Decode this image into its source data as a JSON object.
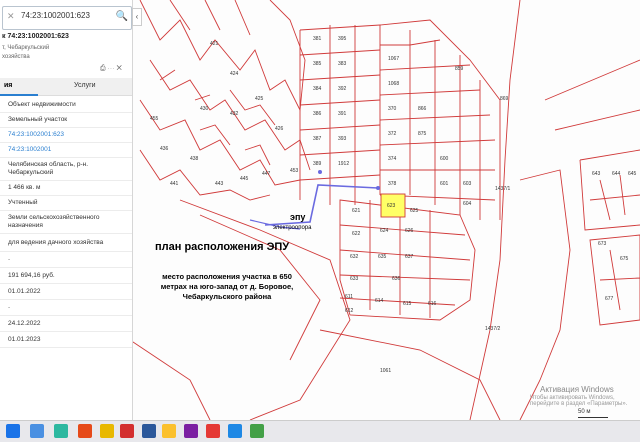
{
  "search": {
    "value": "74:23:1002001:623"
  },
  "parcel": {
    "title": "к 74:23:1002001:623",
    "location_short": "т, Чебаркульский",
    "category_short": "хозяйства"
  },
  "tabs": [
    {
      "label": "ия"
    },
    {
      "label": "Услуги"
    }
  ],
  "info_rows": [
    {
      "text": "Объект недвижимости"
    },
    {
      "text": "Земельный участок"
    },
    {
      "text": "74:23:1002001:623"
    },
    {
      "text": "74:23:1002001"
    },
    {
      "text": "Челябинская область, р-н. Чебаркульский"
    },
    {
      "text": "1 466 кв. м"
    },
    {
      "text": "Учтенный"
    },
    {
      "text": "Земли сельскохозяйственного назначения"
    },
    {
      "text": "для ведения дачного хозяйства"
    },
    {
      "text": "-"
    },
    {
      "text": "191 694,16 руб."
    },
    {
      "text": "01.01.2022"
    },
    {
      "text": "-"
    },
    {
      "text": "24.12.2022"
    },
    {
      "text": "01.01.2023"
    }
  ],
  "map": {
    "plan_title": "план расположения ЭПУ",
    "epu_label": "эпу",
    "pole_label": "электроопора",
    "description": "место расположения участка в 650 метрах на юго-запад от д. Боровое, Чебаркульского района",
    "plot_numbers": [
      "381",
      "385",
      "383",
      "384",
      "392",
      "386",
      "387",
      "389",
      "391",
      "1912",
      "393",
      "395",
      "370",
      "372",
      "374",
      "378",
      "1067",
      "1068",
      "866",
      "875",
      "600",
      "601",
      "603",
      "604",
      "623",
      "624",
      "625",
      "626",
      "622",
      "621",
      "632",
      "635",
      "637",
      "633",
      "636",
      "611",
      "612",
      "614",
      "615",
      "616",
      "421",
      "424",
      "425",
      "426",
      "430",
      "432",
      "436",
      "438",
      "441",
      "443",
      "445",
      "447",
      "453",
      "455",
      "458",
      "462",
      "1061",
      "859",
      "869",
      "643",
      "644",
      "645",
      "673",
      "675",
      "677",
      "1437/1",
      "1437/2"
    ],
    "highlighted_plot": "623",
    "highlight_color": "#ffff66",
    "line_color": "#d03a3a",
    "epu_line_color": "#6a6ae0"
  },
  "watermark": {
    "line1": "Активация Windows",
    "line2": "Чтобы активировать Windows, перейдите в раздел «Параметры»."
  },
  "scale": {
    "label": "50 м"
  }
}
